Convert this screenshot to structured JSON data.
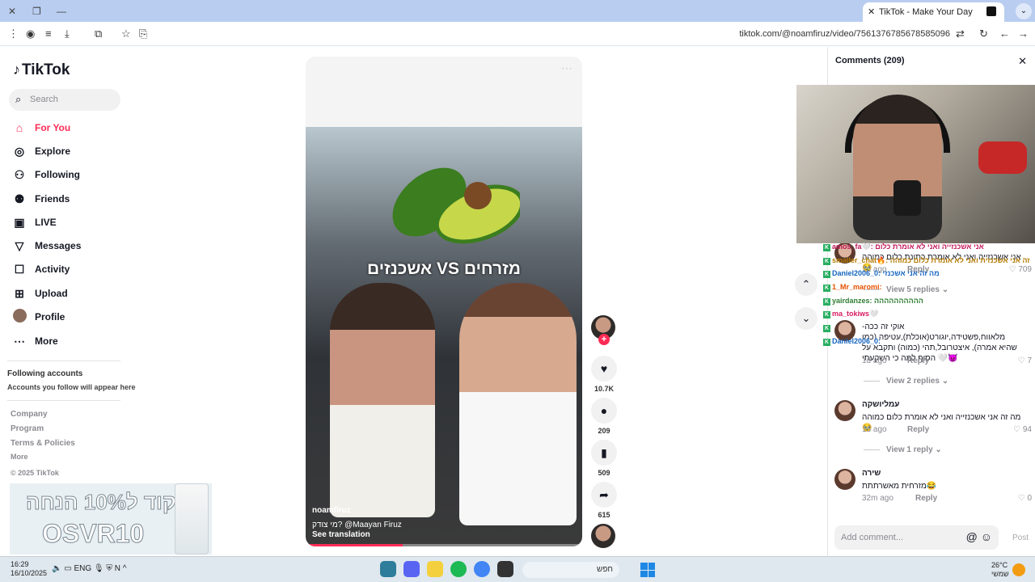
{
  "browser": {
    "tab_title": "TikTok - Make Your Day",
    "tab_close": "✕",
    "new_tab": "+",
    "url": "tiktok.com/@noamfiruz/video/7561376785678585096"
  },
  "sidebar": {
    "logo": "TikTok",
    "search_placeholder": "Search",
    "nav": [
      {
        "label": "For You",
        "icon": "home-icon"
      },
      {
        "label": "Explore",
        "icon": "compass-icon"
      },
      {
        "label": "Following",
        "icon": "following-icon"
      },
      {
        "label": "Friends",
        "icon": "friends-icon"
      },
      {
        "label": "LIVE",
        "icon": "live-icon"
      },
      {
        "label": "Messages",
        "icon": "messages-icon"
      },
      {
        "label": "Activity",
        "icon": "activity-icon"
      },
      {
        "label": "Upload",
        "icon": "upload-icon"
      },
      {
        "label": "Profile",
        "icon": "profile-avatar"
      },
      {
        "label": "More",
        "icon": "more-icon"
      }
    ],
    "following_heading": "Following accounts",
    "following_sub": "Accounts you follow will appear here",
    "footer": [
      "Company",
      "Program",
      "Terms & Policies",
      "More"
    ],
    "copyright": "© 2025 TikTok",
    "ad_line1": "קוד ל10% הנחה",
    "ad_line2": "OSVR10"
  },
  "video": {
    "overlay_title": "אשכנזים VS מזרחים",
    "username": "noamfiruz",
    "caption": "מי צודק? @Maayan Firuz",
    "see_translation": "See translation",
    "progress": 0.35
  },
  "actions": {
    "likes": "10.7K",
    "comments": "209",
    "saves": "509",
    "shares": "615"
  },
  "comments_panel": {
    "title": "Comments (209)",
    "items": [
      {
        "user": "",
        "text": "אני אשכנזייה ואני לא אומרת כתונת כלום כמוהה🥹",
        "time": "1d ago",
        "reply": "Reply",
        "likes": "709",
        "view_replies": "View 5 replies"
      },
      {
        "user": "",
        "text": "אוקי זה ככה- מלאווח,פשטידה,יוגורט(אוכלת),עטיפה (כמו שהיא אמרה), איצטרובל,תהי (כמוה) ותקבא על הסוף למה כי השקעתי 🤍😈",
        "time": "1d ago",
        "reply": "Reply",
        "likes": "7",
        "view_replies": "View 2 replies"
      },
      {
        "user": "עמליושקה",
        "text": "מה זה אני אשכנזייה ואני לא אומרת כלום כמוהה🥹",
        "time": "1d ago",
        "reply": "Reply",
        "likes": "94",
        "view_replies": "View 1 reply"
      },
      {
        "user": "שירה",
        "text": "מזרחית מאשרתתת😂",
        "time": "32m ago",
        "reply": "Reply",
        "likes": "0"
      }
    ],
    "add_placeholder": "Add comment...",
    "post_label": "Post"
  },
  "stream_chat": [
    "amos_fa🤍: אני אשכנזייה ואני לא אומרת כלום",
    "smaller_chat🔥: זה אני אשכנזית ואני לא אומרת כלום כמוהה",
    "Daniel2006_0: מה זה אני אשכנזי",
    "1_Mr_maromi: ",
    "yairdanzes: הההההההההה",
    "ma_tokiws🤍",
    "",
    "Daniel2006_0: "
  ],
  "taskbar": {
    "time": "16:29",
    "date": "16/10/2025",
    "lang": "ENG",
    "search_text": "חפש",
    "temp": "26°C",
    "weather": "שמשי"
  }
}
